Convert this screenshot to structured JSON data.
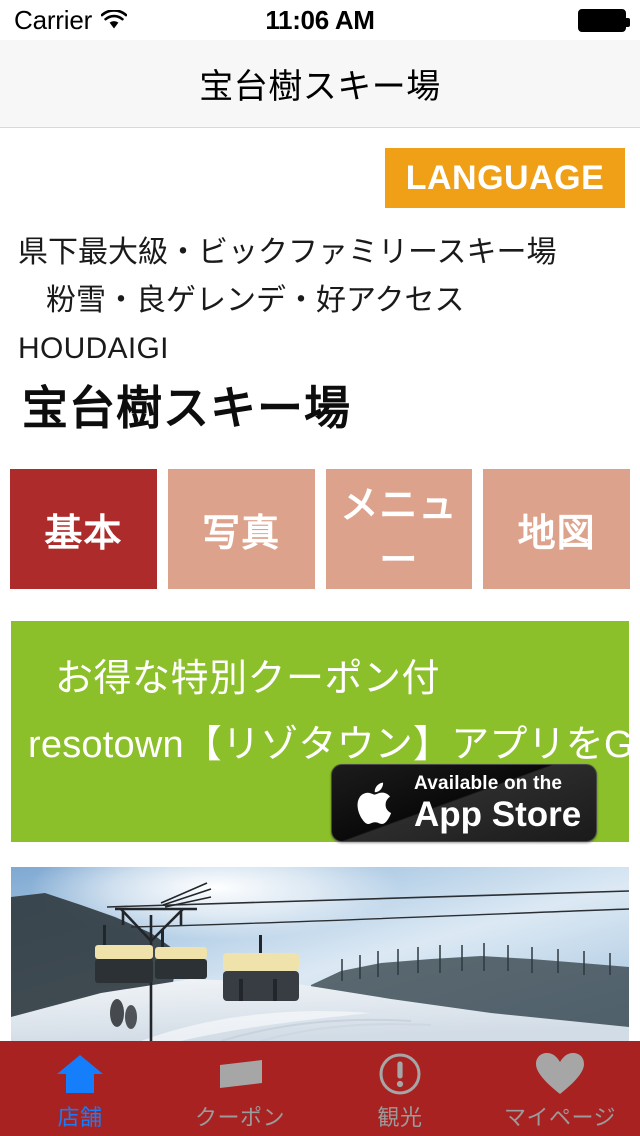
{
  "status_bar": {
    "carrier": "Carrier",
    "wifi_icon": "wifi-icon",
    "time": "11:06 AM",
    "battery_icon": "battery-full-icon"
  },
  "nav": {
    "title": "宝台樹スキー場"
  },
  "language_button": {
    "label": "LANGUAGE",
    "color": "#f0a017"
  },
  "description": {
    "line1": "県下最大級・ビックファミリースキー場",
    "line2": "粉雪・良ゲレンデ・好アクセス",
    "line3": "HOUDAIGI"
  },
  "shop": {
    "title": "宝台樹スキー場"
  },
  "category_tabs": {
    "active_color": "#ae2b2b",
    "inactive_color": "#dda28b",
    "items": [
      {
        "label": "基本",
        "active": true
      },
      {
        "label": "写真",
        "active": false
      },
      {
        "label": "メニュー",
        "active": false
      },
      {
        "label": "地図",
        "active": false
      }
    ]
  },
  "promo": {
    "background": "#8cc02a",
    "line1": "お得な特別クーポン付",
    "line2": "resotown【リゾタウン】アプリをGET!",
    "appstore": {
      "small_text": "Available on the",
      "big_text": "App Store",
      "apple_icon": "apple-logo-icon"
    }
  },
  "photo": {
    "alt": "ski-lift-snow-slope-photo"
  },
  "tabbar": {
    "background": "#a82222",
    "active_color": "#147efb",
    "inactive_color": "#9b9b9b",
    "items": [
      {
        "label": "店舗",
        "icon": "home-icon",
        "active": true
      },
      {
        "label": "クーポン",
        "icon": "coupon-ticket-icon",
        "active": false
      },
      {
        "label": "観光",
        "icon": "exclamation-circle-icon",
        "active": false
      },
      {
        "label": "マイページ",
        "icon": "heart-icon",
        "active": false
      }
    ]
  }
}
